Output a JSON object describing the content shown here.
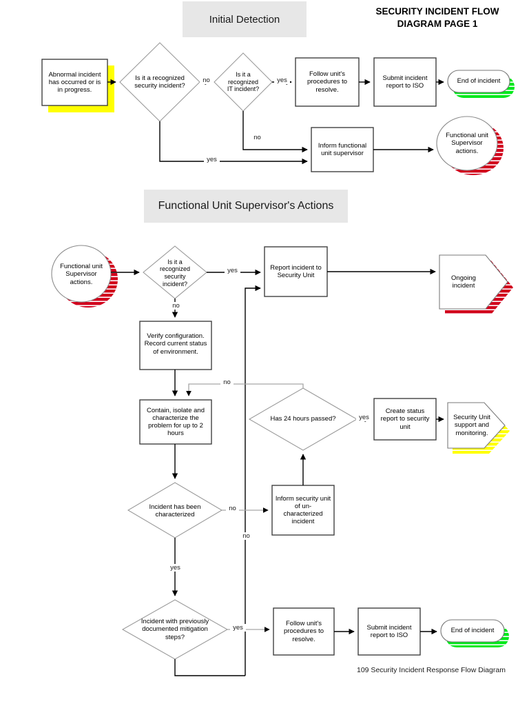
{
  "document": {
    "title_line1": "SECURITY INCIDENT FLOW",
    "title_line2": "DIAGRAM PAGE 1",
    "caption": "109 Security Incident Response Flow Diagram"
  },
  "banners": [
    {
      "id": "initial-detection",
      "label": "Initial Detection"
    },
    {
      "id": "functional-unit-supervisors-actions",
      "label": "Functional Unit Supervisor's Actions"
    }
  ],
  "colors": {
    "shadow_yellow": "#ffff00",
    "shadow_green": "#00e81b",
    "shadow_red": "#d1001c",
    "node_stroke": "#404040",
    "diamond_stroke": "#808080",
    "connector_dark": "#000000",
    "connector_light": "#a6a6a6",
    "banner_fill": "#e7e7e7"
  },
  "sections": {
    "initial_detection": {
      "nodes": [
        {
          "id": "abnormal-incident",
          "shape": "process",
          "shadow": "yellow",
          "label": "Abnormal incident\nhas occurred or is\nin progress."
        },
        {
          "id": "is-recognized-security-incident",
          "shape": "decision",
          "shadow": "none",
          "label": "Is it a recognized\nsecurity incident?"
        },
        {
          "id": "is-recognized-it-incident",
          "shape": "decision",
          "shadow": "none",
          "label": "Is it a\nrecognized\nIT incident?"
        },
        {
          "id": "follow-units-procedures",
          "shape": "process",
          "shadow": "none",
          "label": "Follow unit's\nprocedures  to\nresolve."
        },
        {
          "id": "submit-incident-report-iso",
          "shape": "process",
          "shadow": "none",
          "label": "Submit incident\nreport to ISO"
        },
        {
          "id": "end-of-incident",
          "shape": "terminator",
          "shadow": "green",
          "label": "End of incident"
        },
        {
          "id": "inform-functional-unit-supervisor",
          "shape": "process",
          "shadow": "none",
          "label": "Inform functional\nunit supervisor"
        },
        {
          "id": "functional-unit-supervisor-actions",
          "shape": "circle",
          "shadow": "red",
          "label": "Functional unit\nSupervisor\nactions."
        }
      ],
      "edge_labels": [
        {
          "id": "label-no-1",
          "text": "no"
        },
        {
          "id": "label-yes-1",
          "text": "yes"
        },
        {
          "id": "label-no-2",
          "text": "no"
        },
        {
          "id": "label-yes-2",
          "text": "yes"
        }
      ]
    },
    "supervisor_actions": {
      "nodes": [
        {
          "id": "functional-unit-supervisor-actions-start",
          "shape": "circle",
          "shadow": "red",
          "label": "Functional unit\nSupervisor\nactions."
        },
        {
          "id": "is-recognized-security-incident-2",
          "shape": "decision",
          "shadow": "none",
          "label": "Is it a\nrecognized\nsecurity\nincident?"
        },
        {
          "id": "report-incident-security-unit",
          "shape": "process",
          "shadow": "none",
          "label": "Report incident to\nSecurity Unit"
        },
        {
          "id": "ongoing-incident",
          "shape": "arrow-pentagon",
          "shadow": "red",
          "label": "Ongoing\nincident"
        },
        {
          "id": "verify-configuration",
          "shape": "process",
          "shadow": "none",
          "label": "Verify configuration.\nRecord current status\nof environment."
        },
        {
          "id": "contain-isolate-characterize",
          "shape": "process",
          "shadow": "none",
          "label": "Contain, isolate and\ncharacterize the\nproblem for up to 2\nhours"
        },
        {
          "id": "has-24-hours-passed",
          "shape": "decision",
          "shadow": "none",
          "label": "Has 24 hours passed?"
        },
        {
          "id": "create-status-report",
          "shape": "process",
          "shadow": "none",
          "label": "Create status\nreport to security\nunit"
        },
        {
          "id": "security-unit-support",
          "shape": "arrow-pentagon",
          "shadow": "yellow",
          "label": "Security Unit\nsupport and\nmonitoring."
        },
        {
          "id": "incident-has-been-characterized",
          "shape": "decision",
          "shadow": "none",
          "label": "Incident has been\ncharacterized"
        },
        {
          "id": "inform-security-unit-uncharacterized",
          "shape": "process",
          "shadow": "none",
          "label": "Inform security unit\nof un-\ncharacterized\nincident"
        },
        {
          "id": "incident-previously-documented",
          "shape": "decision",
          "shadow": "none",
          "label": "Incident with previously\ndocumented mitigation\nsteps?"
        },
        {
          "id": "follow-units-procedures-2",
          "shape": "process",
          "shadow": "none",
          "label": "Follow unit's\nprocedures  to\nresolve."
        },
        {
          "id": "submit-incident-report-iso-2",
          "shape": "process",
          "shadow": "none",
          "label": "Submit incident\nreport to ISO"
        },
        {
          "id": "end-of-incident-2",
          "shape": "terminator",
          "shadow": "green",
          "label": "End of incident"
        }
      ],
      "edge_labels": [
        {
          "id": "label-yes-3",
          "text": "yes"
        },
        {
          "id": "label-no-3",
          "text": "no"
        },
        {
          "id": "label-no-loop-24h",
          "text": "no"
        },
        {
          "id": "label-yes-24h",
          "text": "yes"
        },
        {
          "id": "label-no-characterized",
          "text": "no"
        },
        {
          "id": "label-no-vertical",
          "text": "no"
        },
        {
          "id": "label-yes-characterized",
          "text": "yes"
        },
        {
          "id": "label-yes-mitigation",
          "text": "yes"
        }
      ]
    }
  }
}
